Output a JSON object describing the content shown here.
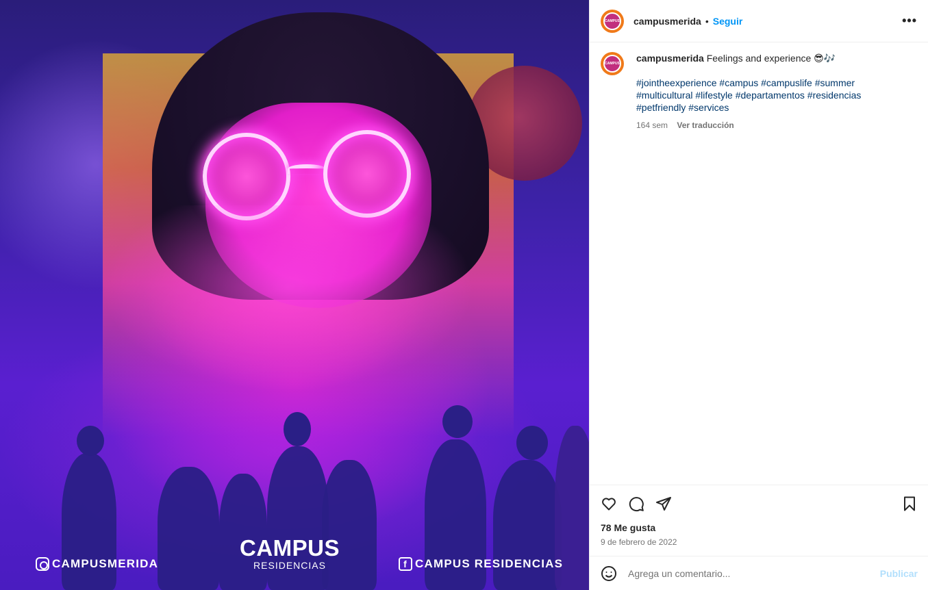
{
  "post": {
    "username": "campusmerida",
    "follow_label": "Seguir",
    "more_label": "•••",
    "caption": {
      "username": "campusmerida",
      "text": "Feelings and experience 😎🎶",
      "hashtags": "#jointheexperience #campus #campuslife #summer #multicultural #lifestyle #departamentos #residencias #petfriendly #services",
      "age": "164 sem",
      "translate_label": "Ver traducción"
    },
    "likes": "78 Me gusta",
    "date": "9 de febrero de 2022",
    "comment": {
      "placeholder": "Agrega un comentario...",
      "publish_label": "Publicar"
    }
  },
  "image_overlay": {
    "instagram_handle": "CAMPUSMERIDA",
    "brand_main": "CAMPUS",
    "brand_sub": "RESIDENCIAS",
    "facebook_handle": "CAMPUS RESIDENCIAS",
    "avatar_text": "CAMPUS"
  },
  "icons": {
    "like": "heart-icon",
    "comment": "comment-icon",
    "share": "share-icon",
    "save": "bookmark-icon",
    "emoji": "emoji-icon"
  },
  "colors": {
    "link": "#0095f6",
    "hashtag": "#00376b",
    "avatar_ring": "#f07a1a",
    "publish_disabled": "#b2dffc"
  }
}
